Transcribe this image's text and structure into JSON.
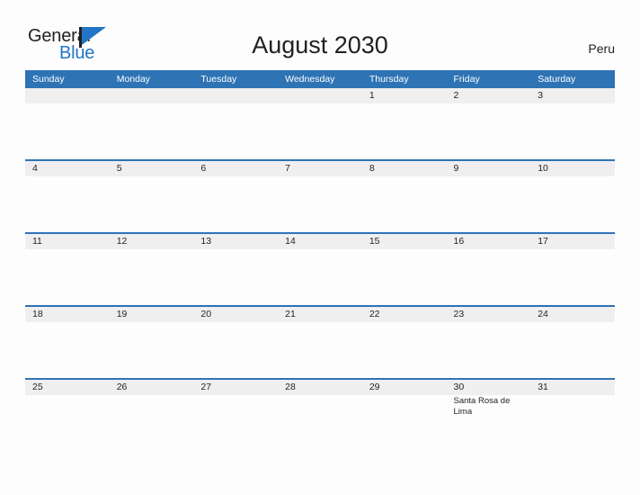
{
  "brand": {
    "name_part1": "General",
    "name_part2": "Blue",
    "flag_icon": "flag-triangle-icon",
    "color_primary": "#2176c7",
    "color_text": "#231f20"
  },
  "header": {
    "title": "August 2030",
    "country": "Peru"
  },
  "calendar": {
    "month": "August",
    "year": "2030",
    "accent_color": "#2e74b5",
    "band_color": "#efefef",
    "weekday_headers": [
      "Sunday",
      "Monday",
      "Tuesday",
      "Wednesday",
      "Thursday",
      "Friday",
      "Saturday"
    ],
    "weeks": [
      [
        {
          "date": "",
          "events": []
        },
        {
          "date": "",
          "events": []
        },
        {
          "date": "",
          "events": []
        },
        {
          "date": "",
          "events": []
        },
        {
          "date": "1",
          "events": []
        },
        {
          "date": "2",
          "events": []
        },
        {
          "date": "3",
          "events": []
        }
      ],
      [
        {
          "date": "4",
          "events": []
        },
        {
          "date": "5",
          "events": []
        },
        {
          "date": "6",
          "events": []
        },
        {
          "date": "7",
          "events": []
        },
        {
          "date": "8",
          "events": []
        },
        {
          "date": "9",
          "events": []
        },
        {
          "date": "10",
          "events": []
        }
      ],
      [
        {
          "date": "11",
          "events": []
        },
        {
          "date": "12",
          "events": []
        },
        {
          "date": "13",
          "events": []
        },
        {
          "date": "14",
          "events": []
        },
        {
          "date": "15",
          "events": []
        },
        {
          "date": "16",
          "events": []
        },
        {
          "date": "17",
          "events": []
        }
      ],
      [
        {
          "date": "18",
          "events": []
        },
        {
          "date": "19",
          "events": []
        },
        {
          "date": "20",
          "events": []
        },
        {
          "date": "21",
          "events": []
        },
        {
          "date": "22",
          "events": []
        },
        {
          "date": "23",
          "events": []
        },
        {
          "date": "24",
          "events": []
        }
      ],
      [
        {
          "date": "25",
          "events": []
        },
        {
          "date": "26",
          "events": []
        },
        {
          "date": "27",
          "events": []
        },
        {
          "date": "28",
          "events": []
        },
        {
          "date": "29",
          "events": []
        },
        {
          "date": "30",
          "events": [
            "Santa Rosa de Lima"
          ]
        },
        {
          "date": "31",
          "events": []
        }
      ]
    ]
  }
}
